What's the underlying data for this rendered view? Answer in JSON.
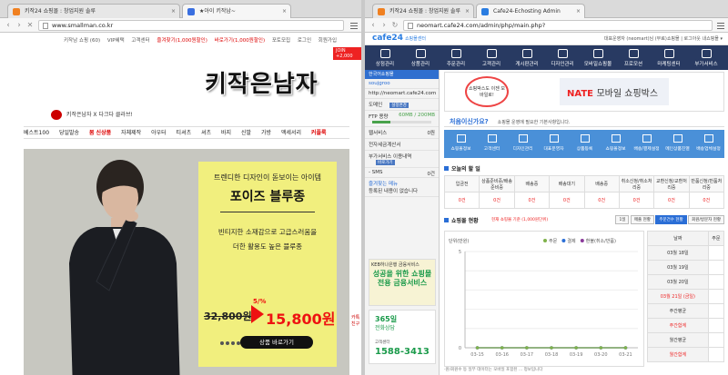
{
  "left": {
    "tabs": [
      {
        "label": "키작24 쇼핑몰 : 창업지원 솔루",
        "active": false
      },
      {
        "label": "★아이 키작남~",
        "active": true
      }
    ],
    "url": "www.smallman.co.kr",
    "top_links": [
      "키작남 쇼핑 (60)",
      "VIP혜택",
      "고객센터",
      "즐겨찾기(1,000원할인)",
      "바로가기(1,000원할인)",
      "포토모집",
      "로그인",
      "회원가입"
    ],
    "join_badge": "JOIN +2,000",
    "logo": "키작은남자",
    "sub_logo": "키작은남자 X 다크다 클라브!",
    "nav": [
      "베스트100",
      "당일발송",
      "봄 신상품",
      "자체제작",
      "아우터",
      "티셔츠",
      "셔츠",
      "바지",
      "신발",
      "가방",
      "액세서리",
      "커플룩"
    ],
    "promo": {
      "line1": "트렌디한 디자인이 돋보이는 아이템",
      "title": "포이즈 블루종",
      "line2": "빈티지한 소재감으로 고급스러움을",
      "line3": "더한 활용도 높은 블루종",
      "old_price": "32,800원",
      "discount": "5/%",
      "new_price": "15,800원",
      "button": "상품 바로가기"
    },
    "side_ad": "카톡\n친구"
  },
  "right": {
    "tabs": [
      {
        "label": "키작24 쇼핑몰 : 창업지원 솔루",
        "active": false
      },
      {
        "label": "Cafe24-Echosting Admin",
        "active": true
      }
    ],
    "url": "neomart.cafe24.com/admin/php/main.php?",
    "logo": "cafe24",
    "logo_sub": "쇼핑몰센터",
    "header_right": "대표운영자 (neomart)님   (무료)쇼핑몰 |  로그아웃   내쇼핑몰 ▾",
    "menu": [
      "상점관리",
      "상품관리",
      "주문관리",
      "고객관리",
      "게시판관리",
      "디자인관리",
      "모바일쇼핑몰",
      "프로모션",
      "마케팅센터",
      "부가서비스"
    ],
    "side": {
      "header": "한국어쇼핑몰",
      "user": "soujgroo",
      "domain": "http://neomart.cafe24.com",
      "domain_label": "도메인",
      "domain_btn": "설정변경",
      "ftp_label": "FTP 용량",
      "ftp_value": "60MB / 200MB",
      "web_label": "웹서비스",
      "web_value": "0원",
      "web_contract": "전자세금계산서",
      "extra_label": "부가서비스 이용내역",
      "extra_btn": "바로가기",
      "sms_label": "- SMS",
      "sms_value": "0건",
      "fav_label": "즐겨찾는 메뉴",
      "fav_empty": "등록된 내용이 없습니다",
      "keb_title": "KEB하나은행 금융서비스",
      "keb_main": "성공을 위한 쇼핑몰 전용 금융서비스",
      "tel_365": "365일",
      "tel_label": "전화상담",
      "tel_sub": "고객센터",
      "tel_num": "1588-3413"
    },
    "ad": {
      "bubble": "쇼핑박스도 이젠 모바일로!",
      "nate": "NATE",
      "nate_rest": "모바일 쇼핑박스"
    },
    "welcome_title": "처음이신가요?",
    "welcome_text": "쇼핑몰 운영에 필요한 기본사항입니다.",
    "quick": [
      "쇼핑몰정보",
      "고객센터",
      "디자인관리",
      "대표운영자",
      "상품등록",
      "쇼핑몰정보",
      "배송/결제설정",
      "메인상품진열",
      "배송업체설정"
    ],
    "order_title": "오늘의 할 일",
    "order_headers": [
      "입금전",
      "상품준비중/배송준비중",
      "배송중",
      "배송대기",
      "배송중",
      "취소신청/취소처리중",
      "교환신청/교환처리중",
      "반품신청/반품처리중"
    ],
    "order_values": [
      "0건",
      "0건",
      "0건",
      "0건",
      "0건",
      "0건",
      "0건",
      "0건"
    ],
    "sales_title": "쇼핑몰 현황",
    "sales_sub": "현재 쇼핑몰 기준 (1,000원단위)",
    "sales_btns": [
      "1일",
      "매출 현황",
      "주문건수 현황",
      "회원/방문자 현황"
    ],
    "chart_legend": [
      "주문",
      "결제",
      "환불(취소/반품)"
    ],
    "chart_ylabel": "단위(만원)",
    "chart_note": "·원/회원수 등 일부 데이터는 모바일 포함된 ... 정보입니다",
    "sales_table": [
      [
        "날짜",
        "주문"
      ],
      [
        "03월 18일",
        ""
      ],
      [
        "03월 19일",
        ""
      ],
      [
        "03월 20일",
        ""
      ],
      [
        "03월 21일 (금일)",
        ""
      ],
      [
        "주간평균",
        ""
      ],
      [
        "주간합계",
        ""
      ],
      [
        "월간평균",
        ""
      ],
      [
        "월간합계",
        ""
      ]
    ]
  },
  "chart_data": {
    "type": "line",
    "x": [
      "03-15",
      "03-16",
      "03-17",
      "03-18",
      "03-19",
      "03-20",
      "03-21"
    ],
    "series": [
      {
        "name": "주문",
        "values": [
          0,
          0,
          0,
          0,
          0,
          0,
          0
        ]
      },
      {
        "name": "결제",
        "values": [
          0,
          0,
          0,
          0,
          0,
          0,
          0
        ]
      },
      {
        "name": "환불(취소/반품)",
        "values": [
          0,
          0,
          0,
          0,
          0,
          0,
          0
        ]
      }
    ],
    "ylabel": "단위(만원)",
    "ylim": [
      0,
      5
    ],
    "grid": true,
    "legend": "top-right"
  }
}
